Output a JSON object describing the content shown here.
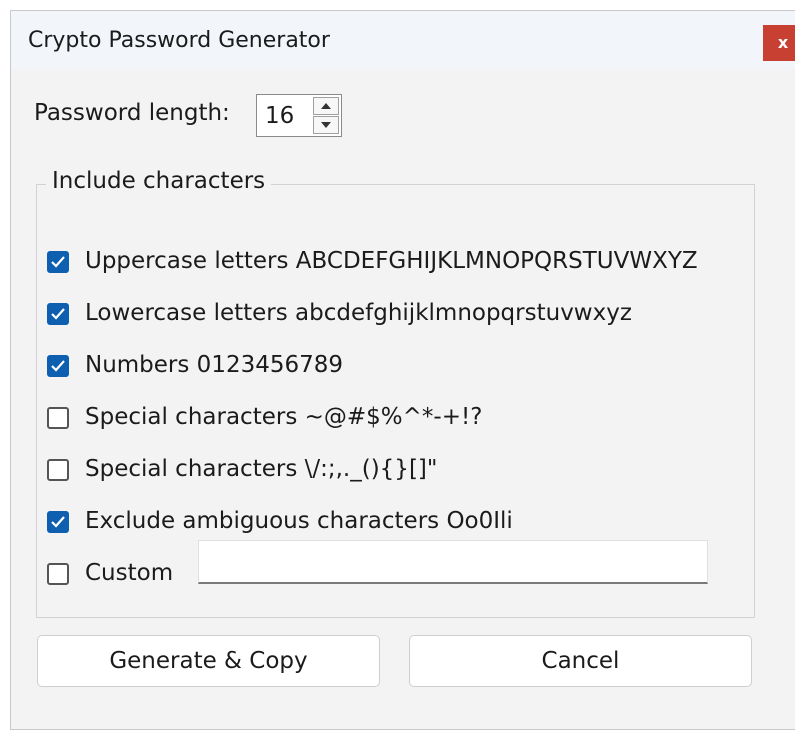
{
  "window": {
    "title": "Crypto Password Generator",
    "close_label": "x"
  },
  "length": {
    "label": "Password length:",
    "value": "16"
  },
  "group": {
    "title": "Include characters",
    "options": [
      {
        "label": "Uppercase letters ABCDEFGHIJKLMNOPQRSTUVWXYZ",
        "checked": true
      },
      {
        "label": "Lowercase letters abcdefghijklmnopqrstuvwxyz",
        "checked": true
      },
      {
        "label": "Numbers 0123456789",
        "checked": true
      },
      {
        "label": "Special characters ~@#$%^*-+!?",
        "checked": false
      },
      {
        "label": "Special characters \\/:;,._(){}[]\"",
        "checked": false
      },
      {
        "label": "Exclude ambiguous characters Oo0Ili",
        "checked": true
      },
      {
        "label": "Custom",
        "checked": false
      }
    ],
    "custom_value": ""
  },
  "buttons": {
    "generate_label": "Generate & Copy",
    "cancel_label": "Cancel"
  },
  "colors": {
    "accent": "#0e5fb0",
    "close": "#c84031"
  }
}
